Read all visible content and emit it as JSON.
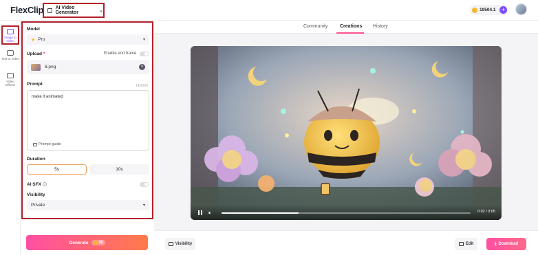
{
  "app": {
    "logo_text": "FlexClip",
    "generator_label": "AI Video Generator",
    "credits": "19504.1"
  },
  "rail": {
    "items": [
      {
        "label": "Image to Video",
        "icon": "image-to-video-icon",
        "active": true
      },
      {
        "label": "Text to Video",
        "icon": "text-to-video-icon",
        "active": false
      },
      {
        "label": "Video Effects",
        "icon": "video-effects-icon",
        "active": false
      }
    ]
  },
  "panel": {
    "model_label": "Model",
    "model_value": "Pro",
    "upload_label": "Upload",
    "enable_end_frame_label": "Enable end frame",
    "upload_file": "8.png",
    "prompt_label": "Prompt",
    "prompt_count": "14/3000",
    "prompt_text": "make it animated",
    "prompt_guide": "Prompt guide",
    "duration_label": "Duration",
    "duration_options": [
      "5s",
      "10s"
    ],
    "duration_selected": "5s",
    "ai_sfx_label": "AI SFX",
    "visibility_label": "Visibility",
    "visibility_value": "Private"
  },
  "generate": {
    "label": "Generate",
    "cost": "20"
  },
  "tabs": [
    "Community",
    "Creations",
    "History"
  ],
  "active_tab": "Creations",
  "player": {
    "current_time": "0:02",
    "duration": "0:05",
    "time_display": "0:02 / 0:05",
    "progress": 0.31
  },
  "bottom": {
    "visibility_label": "Visibility",
    "edit_label": "Edit",
    "download_label": "Download"
  },
  "colors": {
    "accent": "#7b4dff",
    "pink": "#ff4f8a",
    "highlight_box": "#b3202a"
  }
}
